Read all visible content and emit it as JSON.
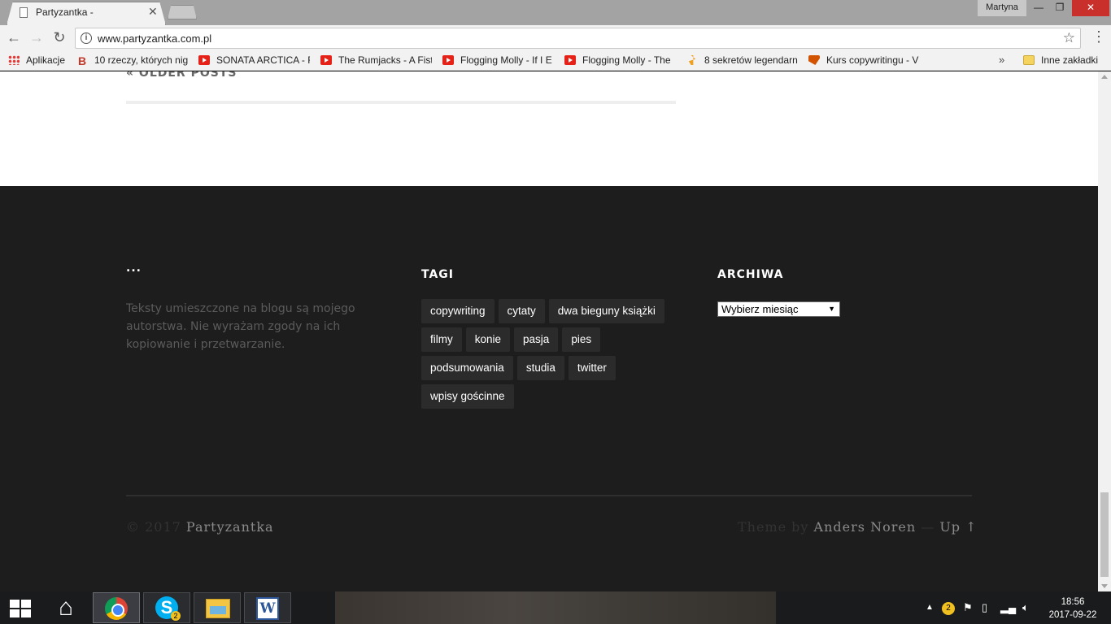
{
  "browser": {
    "tab_title": "Partyzantka -",
    "profile_name": "Martyna",
    "url": "www.partyzantka.com.pl"
  },
  "bookmarks": {
    "items": [
      {
        "label": "Aplikacje",
        "icon": "apps-grid-icon"
      },
      {
        "label": "10 rzeczy, których nig",
        "icon": "blogger-icon"
      },
      {
        "label": "SONATA ARCTICA - F",
        "icon": "youtube-icon"
      },
      {
        "label": "The Rumjacks - A Fist",
        "icon": "youtube-icon"
      },
      {
        "label": "Flogging Molly - If I E",
        "icon": "youtube-icon"
      },
      {
        "label": "Flogging Molly - The",
        "icon": "youtube-icon"
      },
      {
        "label": "8 sekretów legendarn",
        "icon": "flame-icon"
      },
      {
        "label": "Kurs copywritingu - V",
        "icon": "kurs-icon"
      }
    ],
    "more_label": "»",
    "other_label": "Inne zakładki"
  },
  "page": {
    "older_posts": "« Older Posts",
    "footer": {
      "about_title": "...",
      "about_text": "Teksty umieszczone na blogu są mojego autorstwa. Nie wyrażam zgody na ich kopiowanie i przetwarzanie.",
      "tags_title": "Tagi",
      "tags": [
        "copywriting",
        "cytaty",
        "dwa bieguny książki",
        "filmy",
        "konie",
        "pasja",
        "pies",
        "podsumowania",
        "studia",
        "twitter",
        "wpisy gościnne"
      ],
      "archive_title": "Archiwa",
      "archive_select": "Wybierz miesiąc",
      "copyright_prefix": "© 2017",
      "site_name": "Partyzantka",
      "theme_prefix": "Theme by",
      "theme_author": "Anders Noren",
      "up_sep": "—",
      "up_label": "Up ↑"
    }
  },
  "taskbar": {
    "time": "18:56",
    "date": "2017-09-22",
    "skype_badge": "2",
    "tray_badge": "2"
  }
}
